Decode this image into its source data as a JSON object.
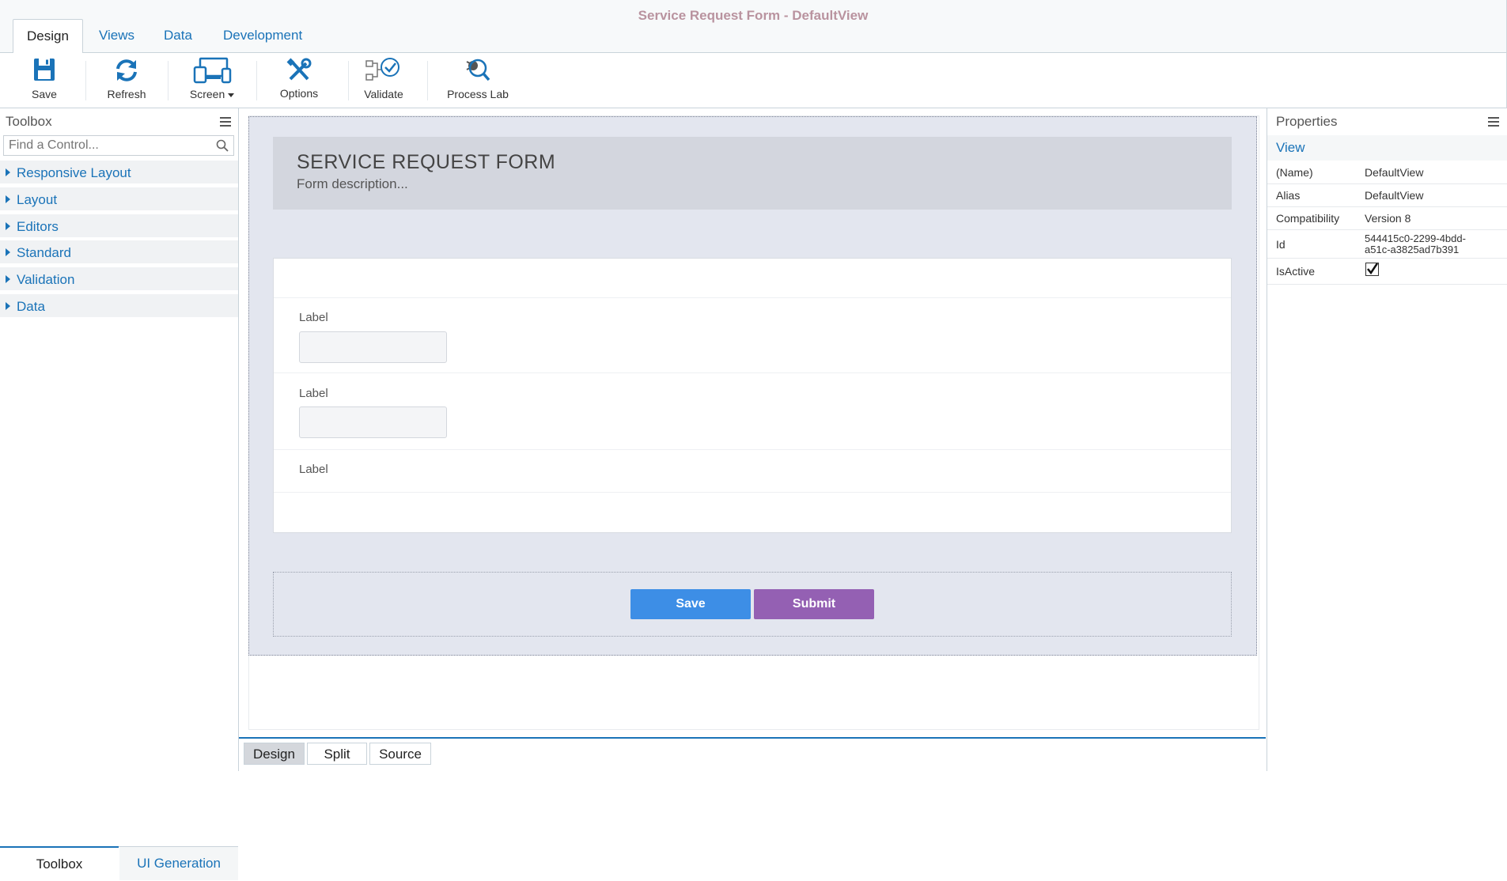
{
  "window": {
    "title": "Service Request Form - DefaultView"
  },
  "ribbon_tabs": [
    {
      "label": "Design",
      "active": true
    },
    {
      "label": "Views",
      "active": false
    },
    {
      "label": "Data",
      "active": false
    },
    {
      "label": "Development",
      "active": false
    }
  ],
  "toolbar": {
    "save": "Save",
    "refresh": "Refresh",
    "screen": "Screen",
    "options": "Options",
    "validate": "Validate",
    "process_lab": "Process Lab"
  },
  "toolbox": {
    "title": "Toolbox",
    "search_placeholder": "Find a Control...",
    "categories": [
      "Responsive Layout",
      "Layout",
      "Editors",
      "Standard",
      "Validation",
      "Data"
    ],
    "bottom_tabs": {
      "toolbox": "Toolbox",
      "ui_generation": "UI Generation"
    }
  },
  "form": {
    "title": "SERVICE REQUEST FORM",
    "description": "Form description...",
    "fields": [
      {
        "label": "Label"
      },
      {
        "label": "Label"
      },
      {
        "label": "Label"
      }
    ],
    "buttons": {
      "save": "Save",
      "submit": "Submit"
    }
  },
  "view_tabs": [
    {
      "label": "Design",
      "active": true
    },
    {
      "label": "Split",
      "active": false
    },
    {
      "label": "Source",
      "active": false
    }
  ],
  "properties": {
    "title": "Properties",
    "section": "View",
    "rows": [
      {
        "key": "(Name)",
        "value": "DefaultView"
      },
      {
        "key": "Alias",
        "value": "DefaultView"
      },
      {
        "key": "Compatibility",
        "value": "Version 8"
      },
      {
        "key": "Id",
        "value": "544415c0-2299-4bdd-",
        "value2": "a51c-a3825ad7b391"
      },
      {
        "key": "IsActive",
        "value": true
      }
    ]
  },
  "colors": {
    "accent": "#1a73b8",
    "save_button": "#3d8ee6",
    "submit_button": "#9460b3",
    "title": "#b9939f"
  }
}
